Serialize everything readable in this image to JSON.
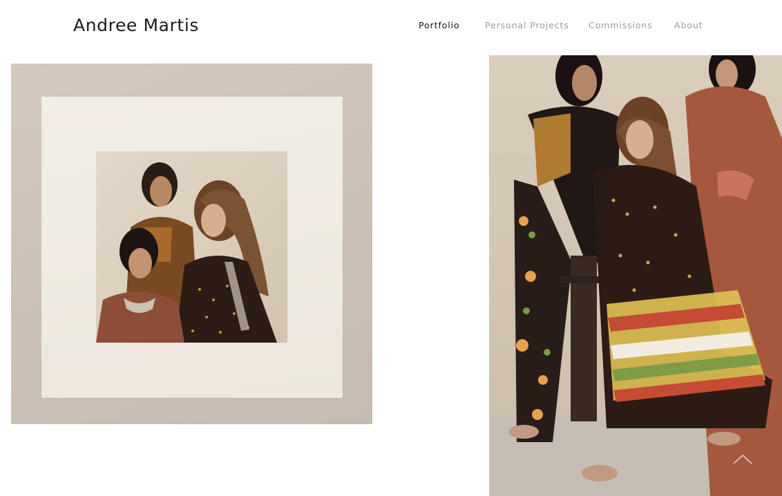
{
  "header": {
    "site_title": "Andree Martis",
    "nav": [
      {
        "label": "Portfolio",
        "active": true
      },
      {
        "label": "Personal Projects",
        "active": false
      },
      {
        "label": "Commissions",
        "active": false
      },
      {
        "label": "About",
        "active": false
      }
    ]
  },
  "icons": {
    "scroll_top": "chevron-up-icon"
  },
  "colors": {
    "active_nav": "#111111",
    "inactive_nav": "#9a9a9a",
    "background": "#ffffff"
  }
}
